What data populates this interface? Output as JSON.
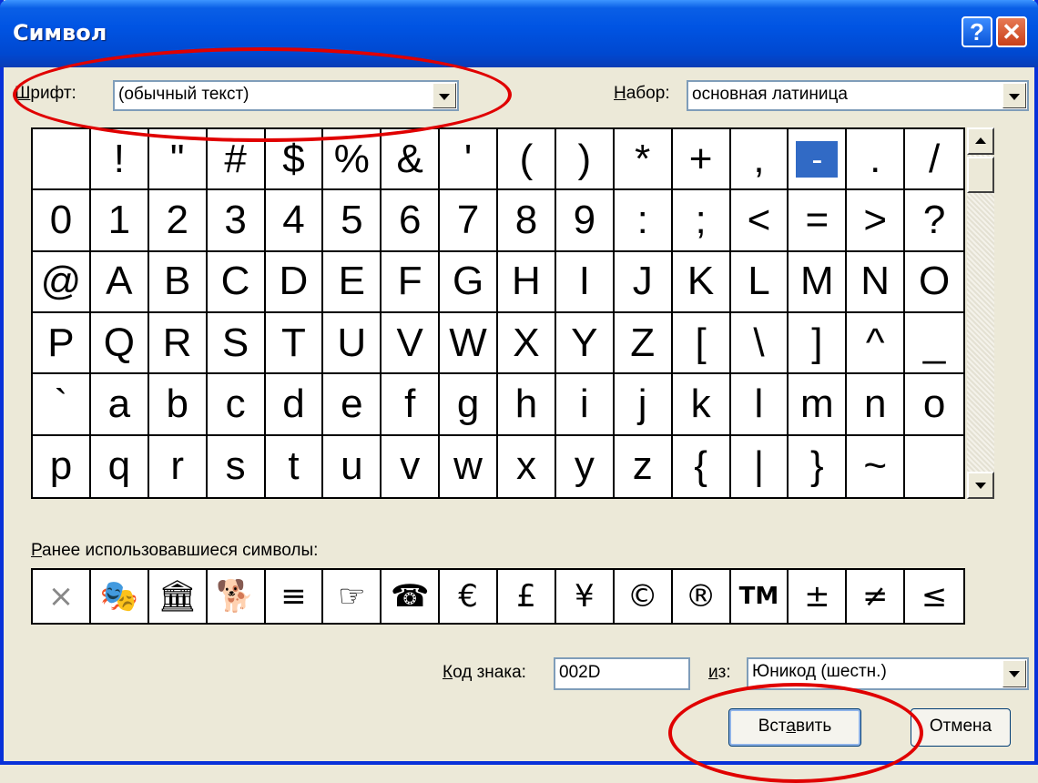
{
  "window": {
    "title": "Символ",
    "help_label": "?",
    "close_label": "✕"
  },
  "font_row": {
    "font_label_u": "Ш",
    "font_label_rest": "рифт:",
    "font_value": "(обычный текст)",
    "subset_label_u": "Н",
    "subset_label_rest": "абор:",
    "subset_value": "основная латиница"
  },
  "symbol_grid": [
    " ",
    "!",
    "\"",
    "#",
    "$",
    "%",
    "&",
    "'",
    "(",
    ")",
    "*",
    "+",
    ",",
    "-",
    ".",
    "/",
    "0",
    "1",
    "2",
    "3",
    "4",
    "5",
    "6",
    "7",
    "8",
    "9",
    ":",
    ";",
    "<",
    "=",
    ">",
    "?",
    "@",
    "A",
    "B",
    "C",
    "D",
    "E",
    "F",
    "G",
    "H",
    "I",
    "J",
    "K",
    "L",
    "M",
    "N",
    "O",
    "P",
    "Q",
    "R",
    "S",
    "T",
    "U",
    "V",
    "W",
    "X",
    "Y",
    "Z",
    "[",
    "\\",
    "]",
    "^",
    "_",
    "`",
    "a",
    "b",
    "c",
    "d",
    "e",
    "f",
    "g",
    "h",
    "i",
    "j",
    "k",
    "l",
    "m",
    "n",
    "o",
    "p",
    "q",
    "r",
    "s",
    "t",
    "u",
    "v",
    "w",
    "x",
    "y",
    "z",
    "{",
    "|",
    "}",
    "~",
    ""
  ],
  "selected_symbol": "-",
  "recent": {
    "label_u": "Р",
    "label_rest": "анее использовавшиеся символы:",
    "symbols": [
      "×",
      "🎭",
      "🏛",
      "🐕",
      "≡",
      "☞",
      "☎",
      "€",
      "£",
      "¥",
      "©",
      "®",
      "TM",
      "±",
      "≠",
      "≤"
    ]
  },
  "code_row": {
    "code_label_u": "К",
    "code_label_rest": "од знака:",
    "code_value": "002D",
    "from_label_u": "и",
    "from_label_rest": "з:",
    "from_value": "Юникод (шестн.)"
  },
  "buttons": {
    "insert_a": "Вст",
    "insert_u": "а",
    "insert_b": "вить",
    "cancel": "Отмена"
  },
  "colors": {
    "selection": "#316ac5",
    "annotation": "#e00000"
  }
}
